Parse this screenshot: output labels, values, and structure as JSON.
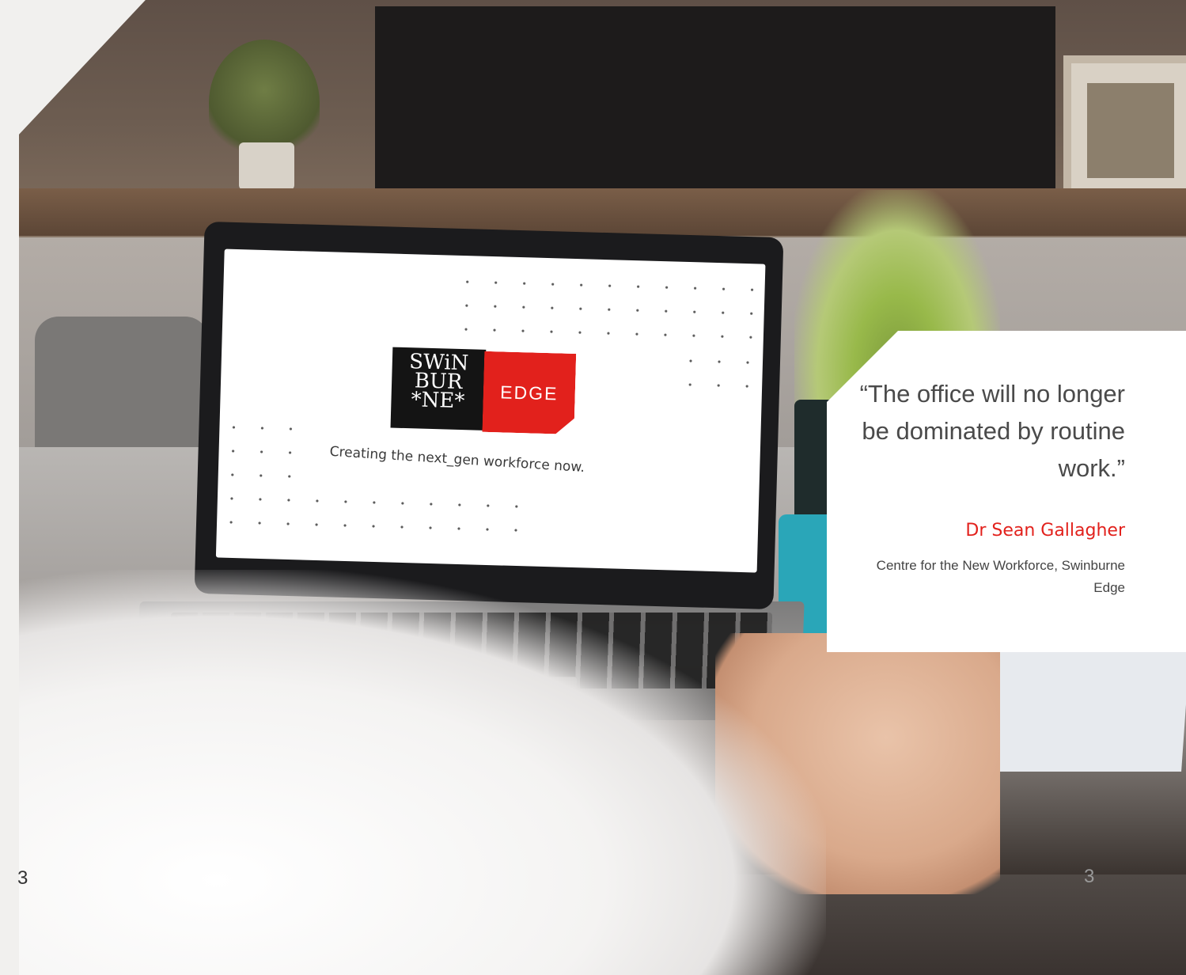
{
  "screen": {
    "logo": {
      "line1": "SWiN",
      "line2": "BUR",
      "line3": "*NE*",
      "edge": "EDGE"
    },
    "tagline": "Creating the next_gen workforce now."
  },
  "quote": {
    "text": "“The office will no longer be dominated by routine work.”",
    "author": "Dr Sean Gallagher",
    "organisation": "Centre for the New Workforce, Swinburne Edge"
  },
  "page_number": {
    "left": "3",
    "right": "3"
  },
  "colors": {
    "accent_red": "#e2211c",
    "background": "#f1f0ee"
  }
}
